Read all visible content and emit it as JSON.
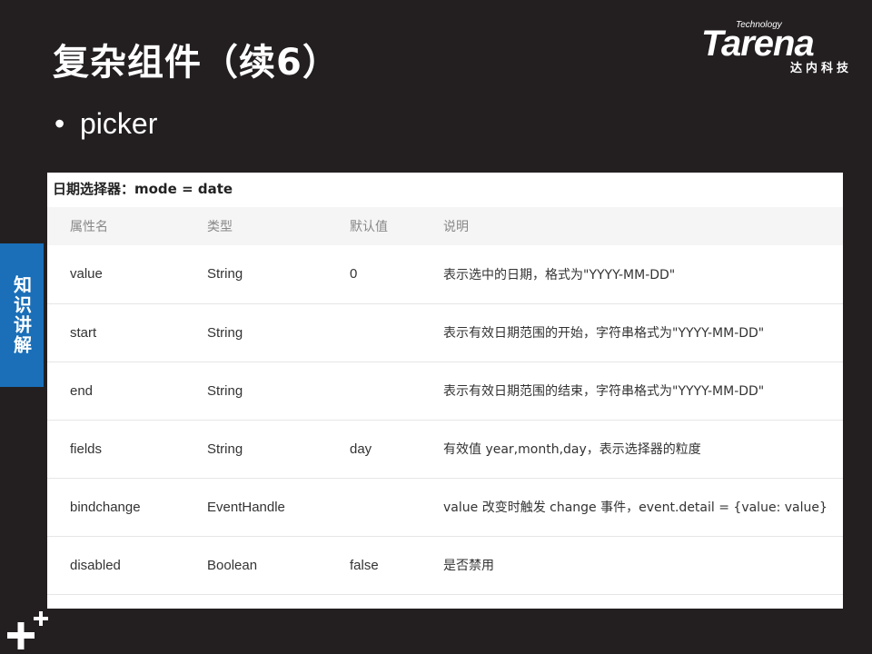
{
  "slide": {
    "title": "复杂组件（续6）",
    "bullet": "picker",
    "side_tab": "知识讲解"
  },
  "logo": {
    "tech": "Technology",
    "brand": "Tarena",
    "sub": "达内科技"
  },
  "table": {
    "caption": "日期选择器：mode = date",
    "headers": [
      "属性名",
      "类型",
      "默认值",
      "说明"
    ],
    "rows": [
      {
        "name": "value",
        "type": "String",
        "default": "0",
        "desc": "表示选中的日期，格式为\"YYYY-MM-DD\""
      },
      {
        "name": "start",
        "type": "String",
        "default": "",
        "desc": "表示有效日期范围的开始，字符串格式为\"YYYY-MM-DD\""
      },
      {
        "name": "end",
        "type": "String",
        "default": "",
        "desc": "表示有效日期范围的结束，字符串格式为\"YYYY-MM-DD\""
      },
      {
        "name": "fields",
        "type": "String",
        "default": "day",
        "desc": "有效值 year,month,day，表示选择器的粒度"
      },
      {
        "name": "bindchange",
        "type": "EventHandle",
        "default": "",
        "desc": "value 改变时触发 change 事件，event.detail = {value: value}"
      },
      {
        "name": "disabled",
        "type": "Boolean",
        "default": "false",
        "desc": "是否禁用"
      }
    ]
  },
  "colors": {
    "background": "#231f20",
    "side_tab": "#1a6fb8",
    "panel": "#ffffff"
  }
}
